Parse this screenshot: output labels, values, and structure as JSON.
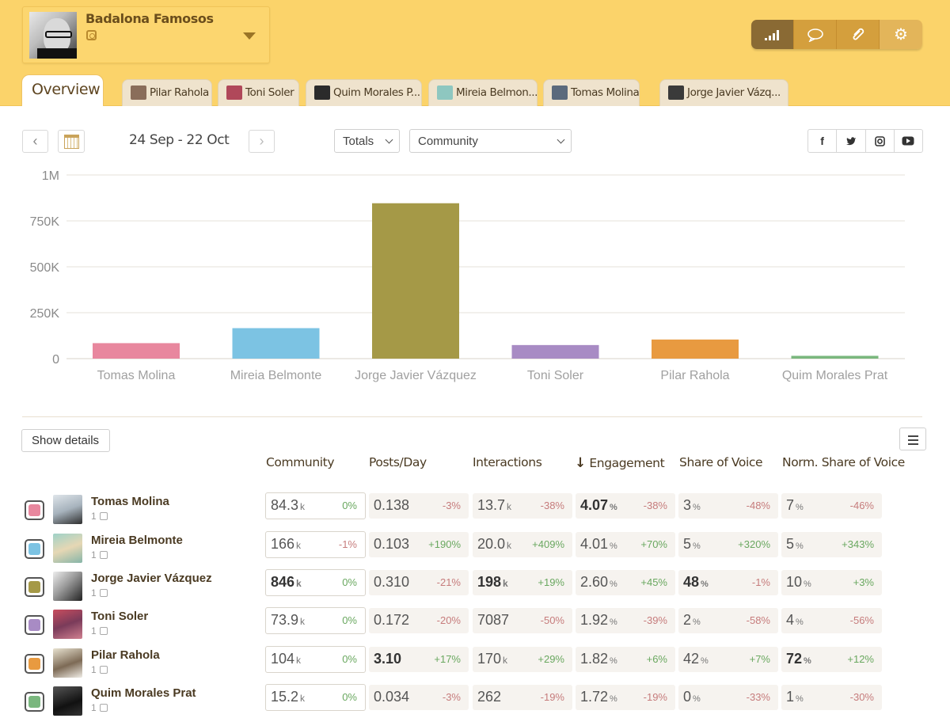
{
  "account": {
    "name": "Badalona Famosos"
  },
  "toolbar": {
    "icons": [
      "signal-bars-icon",
      "speech-bubble-icon",
      "paperclip-icon",
      "gear-icon"
    ]
  },
  "tabs": {
    "overview": "Overview",
    "people": [
      {
        "label": "Pilar Rahola",
        "color": "#8a6d5a"
      },
      {
        "label": "Toni Soler",
        "color": "#b0485a"
      },
      {
        "label": "Quim Morales P...",
        "color": "#2b2b2b"
      },
      {
        "label": "Mireia Belmon...",
        "color": "#8ec7c0"
      },
      {
        "label": "Tomas Molina",
        "color": "#5b6a7c"
      },
      {
        "label": "Jorge Javier Vázq...",
        "color": "#3a3a3a"
      }
    ]
  },
  "controls": {
    "prev": "‹",
    "next": "›",
    "date_range": "24 Sep - 22 Oct",
    "mode_select": "Totals",
    "metric_select": "Community",
    "social": [
      "f",
      "t",
      "ig",
      "yt"
    ]
  },
  "chart_data": {
    "type": "bar",
    "categories": [
      "Tomas Molina",
      "Mireia Belmonte",
      "Jorge Javier Vázquez",
      "Toni Soler",
      "Pilar Rahola",
      "Quim Morales Prat"
    ],
    "values": [
      84300,
      166000,
      846000,
      73900,
      104000,
      15200
    ],
    "colors": [
      "#e8879e",
      "#7cc3e3",
      "#a59947",
      "#a88bc4",
      "#e89a40",
      "#7ab77e"
    ],
    "ylim": [
      0,
      1000000
    ],
    "yticks": [
      0,
      250000,
      500000,
      750000,
      1000000
    ],
    "ytick_labels": [
      "0",
      "250K",
      "500K",
      "750K",
      "1M"
    ],
    "grid": true
  },
  "table": {
    "show_details": "Show details",
    "columns": [
      "Community",
      "Posts/Day",
      "Interactions",
      "Engagement",
      "Share of Voice",
      "Norm. Share of Voice"
    ],
    "sort_arrow": "↓",
    "rows": [
      {
        "name": "Tomas Molina",
        "accounts": "1",
        "color": "#e8879e",
        "community": "84.3",
        "community_unit": "k",
        "community_delta": "0%",
        "posts": "0.138",
        "posts_delta": "-3%",
        "interactions": "13.7",
        "interactions_unit": "k",
        "interactions_delta": "-38%",
        "engagement": "4.07",
        "engagement_delta": "-38%",
        "sov": "3",
        "sov_delta": "-48%",
        "nsov": "7",
        "nsov_delta": "-46%"
      },
      {
        "name": "Mireia Belmonte",
        "accounts": "1",
        "color": "#7cc3e3",
        "community": "166",
        "community_unit": "k",
        "community_delta": "-1%",
        "posts": "0.103",
        "posts_delta": "+190%",
        "interactions": "20.0",
        "interactions_unit": "k",
        "interactions_delta": "+409%",
        "engagement": "4.01",
        "engagement_delta": "+70%",
        "sov": "5",
        "sov_delta": "+320%",
        "nsov": "5",
        "nsov_delta": "+343%"
      },
      {
        "name": "Jorge Javier Vázquez",
        "accounts": "1",
        "color": "#a59947",
        "community": "846",
        "community_unit": "k",
        "community_delta": "0%",
        "posts": "0.310",
        "posts_delta": "-21%",
        "interactions": "198",
        "interactions_unit": "k",
        "interactions_delta": "+19%",
        "engagement": "2.60",
        "engagement_delta": "+45%",
        "sov": "48",
        "sov_delta": "-1%",
        "nsov": "10",
        "nsov_delta": "+3%"
      },
      {
        "name": "Toni Soler",
        "accounts": "1",
        "color": "#a88bc4",
        "community": "73.9",
        "community_unit": "k",
        "community_delta": "0%",
        "posts": "0.172",
        "posts_delta": "-20%",
        "interactions": "7087",
        "interactions_unit": "",
        "interactions_delta": "-50%",
        "engagement": "1.92",
        "engagement_delta": "-39%",
        "sov": "2",
        "sov_delta": "-58%",
        "nsov": "4",
        "nsov_delta": "-56%"
      },
      {
        "name": "Pilar Rahola",
        "accounts": "1",
        "color": "#e89a40",
        "community": "104",
        "community_unit": "k",
        "community_delta": "0%",
        "posts": "3.10",
        "posts_delta": "+17%",
        "interactions": "170",
        "interactions_unit": "k",
        "interactions_delta": "+29%",
        "engagement": "1.82",
        "engagement_delta": "+6%",
        "sov": "42",
        "sov_delta": "+7%",
        "nsov": "72",
        "nsov_delta": "+12%"
      },
      {
        "name": "Quim Morales Prat",
        "accounts": "1",
        "color": "#7ab77e",
        "community": "15.2",
        "community_unit": "k",
        "community_delta": "0%",
        "posts": "0.034",
        "posts_delta": "-3%",
        "interactions": "262",
        "interactions_unit": "",
        "interactions_delta": "-19%",
        "engagement": "1.72",
        "engagement_delta": "-19%",
        "sov": "0",
        "sov_delta": "-33%",
        "nsov": "1",
        "nsov_delta": "-30%"
      }
    ]
  }
}
